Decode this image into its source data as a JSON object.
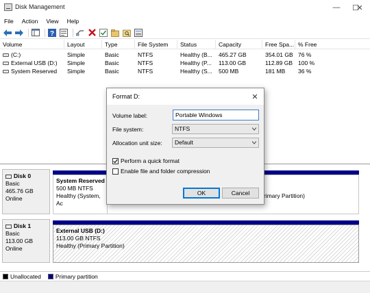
{
  "window": {
    "title": "Disk Management",
    "controls": {
      "minimize": "—",
      "maximize": "☐",
      "close": "✕"
    }
  },
  "menu": [
    "File",
    "Action",
    "View",
    "Help"
  ],
  "toolbar": [
    "back-icon",
    "forward-icon",
    "console-tree-icon",
    "help-icon",
    "properties-icon",
    "connect-icon",
    "delete-icon",
    "check-icon",
    "open-icon",
    "search-icon",
    "show-hide-icon"
  ],
  "volume_table": {
    "columns": [
      "Volume",
      "Layout",
      "Type",
      "File System",
      "Status",
      "Capacity",
      "Free Spa...",
      "% Free"
    ],
    "rows": [
      [
        "(C:)",
        "Simple",
        "Basic",
        "NTFS",
        "Healthy (B...",
        "465.27 GB",
        "354.01 GB",
        "76 %"
      ],
      [
        "External USB (D:)",
        "Simple",
        "Basic",
        "NTFS",
        "Healthy (P...",
        "113.00 GB",
        "112.89 GB",
        "100 %"
      ],
      [
        "System Reserved",
        "Simple",
        "Basic",
        "NTFS",
        "Healthy (S...",
        "500 MB",
        "181 MB",
        "36 %"
      ]
    ]
  },
  "disks": [
    {
      "name": "Disk 0",
      "type": "Basic",
      "size": "465.76 GB",
      "status": "Online",
      "partitions": [
        {
          "name": "System Reserved",
          "size": "500 MB NTFS",
          "status": "Healthy (System, Ac"
        },
        {
          "name": "",
          "size": "",
          "status": "rimary Partition)"
        }
      ]
    },
    {
      "name": "Disk 1",
      "type": "Basic",
      "size": "113.00 GB",
      "status": "Online",
      "partitions": [
        {
          "name": "External USB  (D:)",
          "size": "113.00 GB NTFS",
          "status": "Healthy (Primary Partition)"
        }
      ]
    }
  ],
  "legend": [
    {
      "label": "Unallocated",
      "color": "#000000"
    },
    {
      "label": "Primary partition",
      "color": "#000086"
    }
  ],
  "dialog": {
    "title": "Format D:",
    "close": "✕",
    "volume_label": {
      "label": "Volume label:",
      "value": "Portable Windows"
    },
    "file_system": {
      "label": "File system:",
      "value": "NTFS"
    },
    "allocation": {
      "label": "Allocation unit size:",
      "value": "Default"
    },
    "quick_format": {
      "label": "Perform a quick format",
      "checked": true
    },
    "compression": {
      "label": "Enable file and folder compression",
      "checked": false
    },
    "ok_label": "OK",
    "cancel_label": "Cancel"
  }
}
